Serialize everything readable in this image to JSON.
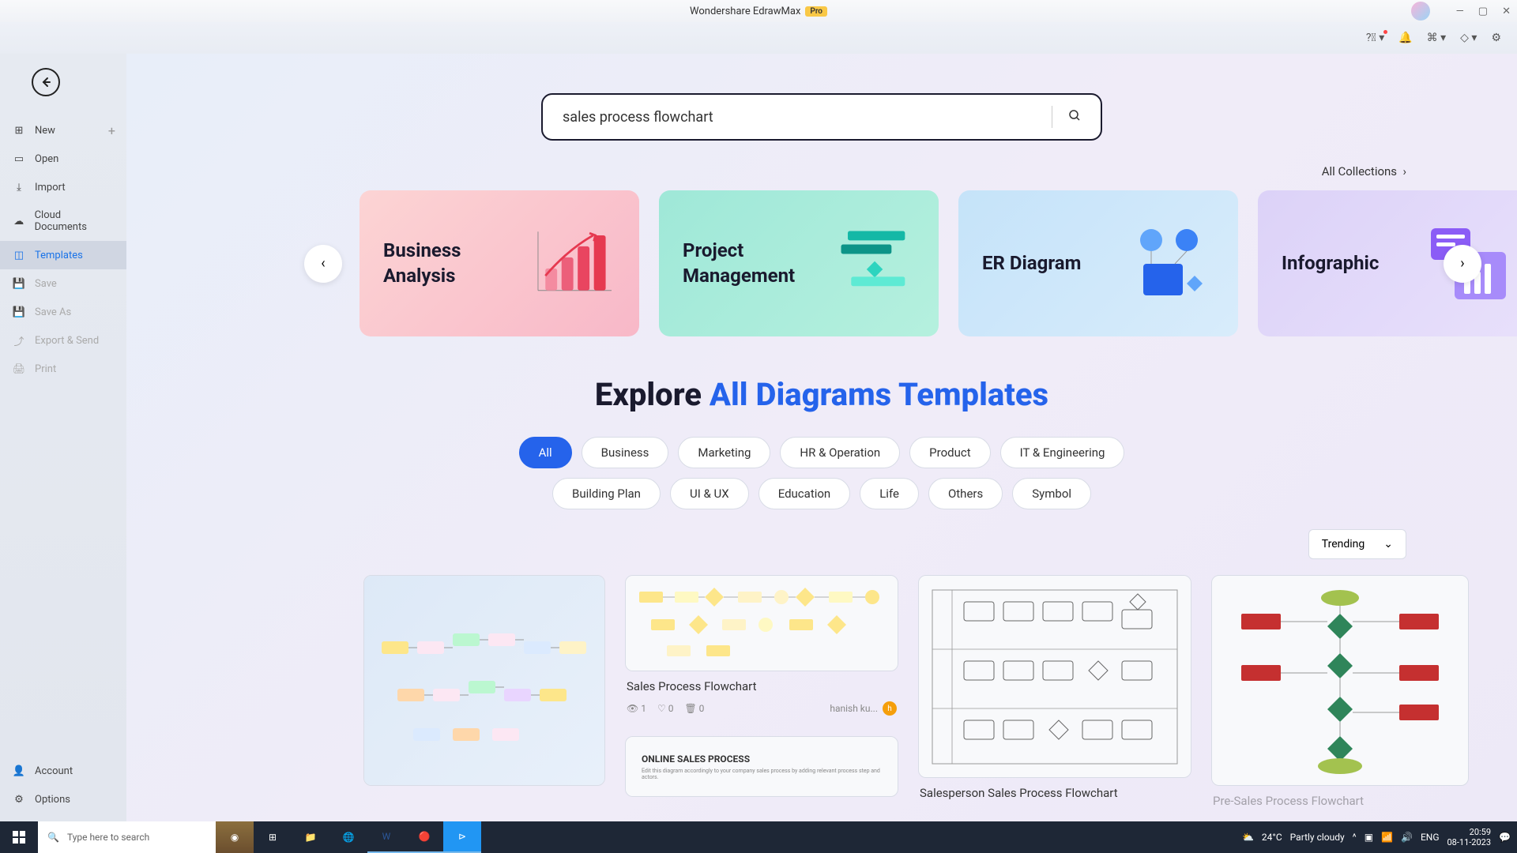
{
  "titlebar": {
    "title": "Wondershare EdrawMax",
    "badge": "Pro"
  },
  "sidebar": {
    "items": [
      {
        "label": "New",
        "icon": "plus"
      },
      {
        "label": "Open",
        "icon": "folder"
      },
      {
        "label": "Import",
        "icon": "import"
      },
      {
        "label": "Cloud Documents",
        "icon": "cloud"
      },
      {
        "label": "Templates",
        "icon": "template"
      },
      {
        "label": "Save",
        "icon": "save"
      },
      {
        "label": "Save As",
        "icon": "saveas"
      },
      {
        "label": "Export & Send",
        "icon": "export"
      },
      {
        "label": "Print",
        "icon": "print"
      }
    ],
    "bottom": [
      {
        "label": "Account",
        "icon": "user"
      },
      {
        "label": "Options",
        "icon": "gear"
      }
    ]
  },
  "search": {
    "value": "sales process flowchart"
  },
  "all_collections": "All Collections",
  "categories": [
    {
      "title": "Business Analysis"
    },
    {
      "title": "Project Management"
    },
    {
      "title": "ER Diagram"
    },
    {
      "title": "Infographic"
    }
  ],
  "explore": {
    "prefix": "Explore ",
    "highlight": "All Diagrams Templates"
  },
  "tags": [
    "All",
    "Business",
    "Marketing",
    "HR & Operation",
    "Product",
    "IT & Engineering",
    "Building Plan",
    "UI & UX",
    "Education",
    "Life",
    "Others",
    "Symbol"
  ],
  "sort": "Trending",
  "templates": {
    "t2_name": "Sales Process Flowchart",
    "t2_views": "1",
    "t2_likes": "0",
    "t2_copies": "0",
    "t2_author": "hanish ku...",
    "t2b_title": "ONLINE SALES PROCESS",
    "t3_name": "Salesperson Sales Process Flowchart",
    "t4_name": "Pre-Sales Process Flowchart"
  },
  "taskbar": {
    "search_placeholder": "Type here to search",
    "temp": "24°C",
    "weather": "Partly cloudy",
    "lang": "ENG",
    "time": "20:59",
    "date": "08-11-2023"
  }
}
